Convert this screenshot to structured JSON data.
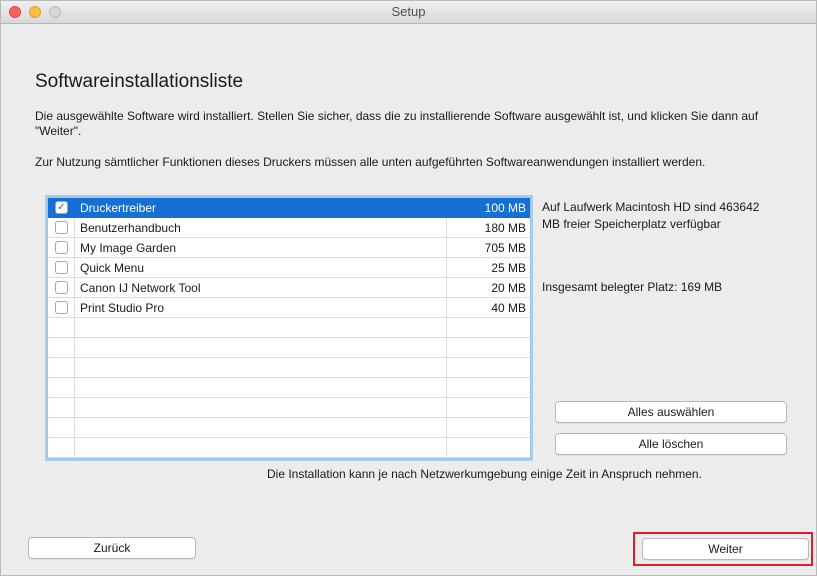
{
  "window": {
    "title": "Setup"
  },
  "heading": "Softwareinstallationsliste",
  "intro": "Die ausgewählte Software wird installiert. Stellen Sie sicher, dass die zu installierende Software ausgewählt ist, und klicken Sie dann auf \"Weiter\".",
  "requirement": "Zur Nutzung sämtlicher Funktionen dieses Druckers müssen alle unten aufgeführten Softwareanwendungen installiert werden.",
  "software_list": [
    {
      "name": "Druckertreiber",
      "size": "100 MB",
      "checked": true,
      "selected": true
    },
    {
      "name": "Benutzerhandbuch",
      "size": "180 MB",
      "checked": false,
      "selected": false
    },
    {
      "name": "My Image Garden",
      "size": "705 MB",
      "checked": false,
      "selected": false
    },
    {
      "name": "Quick Menu",
      "size": "25 MB",
      "checked": false,
      "selected": false
    },
    {
      "name": "Canon IJ Network Tool",
      "size": "20 MB",
      "checked": false,
      "selected": false
    },
    {
      "name": "Print Studio Pro",
      "size": "40 MB",
      "checked": false,
      "selected": false
    }
  ],
  "disk_info": "Auf Laufwerk Macintosh HD sind 463642 MB freier Speicherplatz verfügbar",
  "total_used": "Insgesamt belegter Platz: 169 MB",
  "buttons": {
    "select_all": "Alles auswählen",
    "clear_all": "Alle löschen",
    "back": "Zurück",
    "next": "Weiter"
  },
  "network_note": "Die Installation kann je nach Netzwerkumgebung einige Zeit in Anspruch nehmen.",
  "colors": {
    "selection": "#1670d4",
    "highlight_border": "#d9202c"
  }
}
